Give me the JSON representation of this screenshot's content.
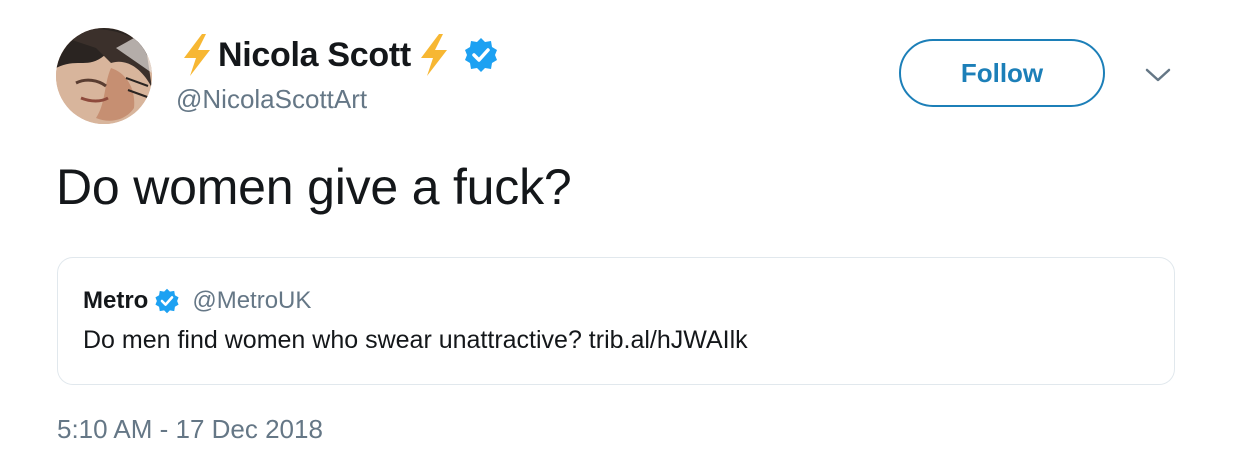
{
  "tweet": {
    "author": {
      "display_name": "Nicola Scott",
      "handle": "@NicolaScottArt",
      "verified_icon": "verified-badge-icon",
      "name_decoration_icon": "lightning-bolt-emoji"
    },
    "follow_label": "Follow",
    "menu_icon": "chevron-down-icon",
    "text": "Do women give a fuck?",
    "timestamp": "5:10 AM - 17 Dec 2018"
  },
  "quoted_tweet": {
    "display_name": "Metro",
    "handle": "@MetroUK",
    "text": "Do men find women who swear unattractive? trib.al/hJWAIlk"
  },
  "colors": {
    "accent": "#1c7fb8",
    "verified": "#1da1f2",
    "bolt": "#f7b733",
    "secondary_text": "#657786",
    "border": "#e1e8ed"
  }
}
